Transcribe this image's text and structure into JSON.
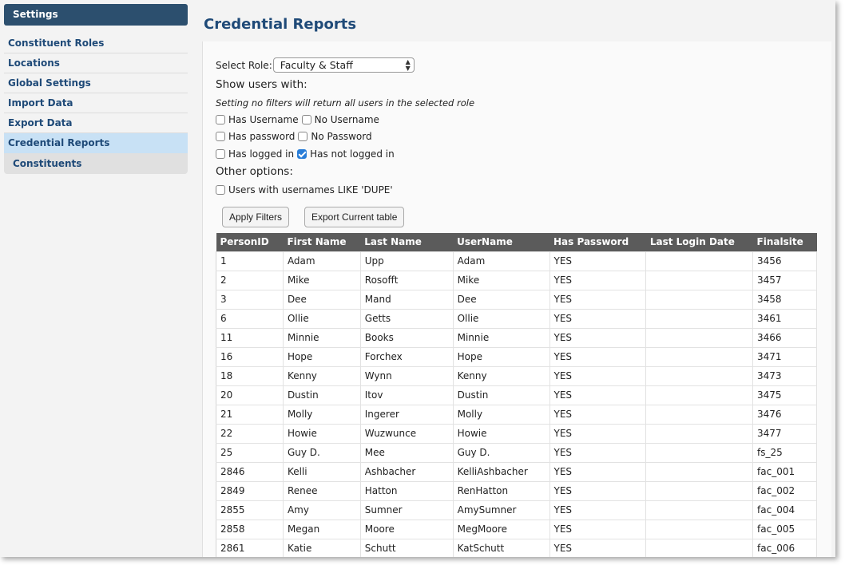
{
  "sidebar": {
    "header": "Settings",
    "items": [
      {
        "label": "Constituent Roles"
      },
      {
        "label": "Locations"
      },
      {
        "label": "Global Settings"
      },
      {
        "label": "Import Data"
      },
      {
        "label": "Export Data"
      },
      {
        "label": "Credential Reports"
      }
    ],
    "sub_item": "Constituents"
  },
  "main": {
    "title": "Credential Reports",
    "role_label": "Select Role:",
    "role_value": "Faculty & Staff",
    "show_users_heading": "Show users with:",
    "filter_note": "Setting no filters will return all users in the selected role",
    "filters": {
      "has_username": "Has Username",
      "no_username": "No Username",
      "has_password": "Has password",
      "no_password": "No Password",
      "has_logged_in": "Has logged in",
      "has_not_logged_in": "Has not logged in"
    },
    "other_heading": "Other options:",
    "dupe_option": "Users with usernames LIKE 'DUPE'",
    "apply_button": "Apply Filters",
    "export_button": "Export Current table"
  },
  "table": {
    "columns": [
      "PersonID",
      "First Name",
      "Last Name",
      "UserName",
      "Has Password",
      "Last Login Date",
      "Finalsite"
    ],
    "rows": [
      [
        "1",
        "Adam",
        "Upp",
        "Adam",
        "YES",
        "",
        "3456"
      ],
      [
        "2",
        "Mike",
        "Rosofft",
        "Mike",
        "YES",
        "",
        "3457"
      ],
      [
        "3",
        "Dee",
        "Mand",
        "Dee",
        "YES",
        "",
        "3458"
      ],
      [
        "6",
        "Ollie",
        "Getts",
        "Ollie",
        "YES",
        "",
        "3461"
      ],
      [
        "11",
        "Minnie",
        "Books",
        "Minnie",
        "YES",
        "",
        "3466"
      ],
      [
        "16",
        "Hope",
        "Forchex",
        "Hope",
        "YES",
        "",
        "3471"
      ],
      [
        "18",
        "Kenny",
        "Wynn",
        "Kenny",
        "YES",
        "",
        "3473"
      ],
      [
        "20",
        "Dustin",
        "Itov",
        "Dustin",
        "YES",
        "",
        "3475"
      ],
      [
        "21",
        "Molly",
        "Ingerer",
        "Molly",
        "YES",
        "",
        "3476"
      ],
      [
        "22",
        "Howie",
        "Wuzwunce",
        "Howie",
        "YES",
        "",
        "3477"
      ],
      [
        "25",
        "Guy D.",
        "Mee",
        "Guy D.",
        "YES",
        "",
        "fs_25"
      ],
      [
        "2846",
        "Kelli",
        "Ashbacher",
        "KelliAshbacher",
        "YES",
        "",
        "fac_001"
      ],
      [
        "2849",
        "Renee",
        "Hatton",
        "RenHatton",
        "YES",
        "",
        "fac_002"
      ],
      [
        "2855",
        "Amy",
        "Sumner",
        "AmySumner",
        "YES",
        "",
        "fac_004"
      ],
      [
        "2858",
        "Megan",
        "Moore",
        "MegMoore",
        "YES",
        "",
        "fac_005"
      ],
      [
        "2861",
        "Katie",
        "Schutt",
        "KatSchutt",
        "YES",
        "",
        "fac_006"
      ]
    ]
  }
}
